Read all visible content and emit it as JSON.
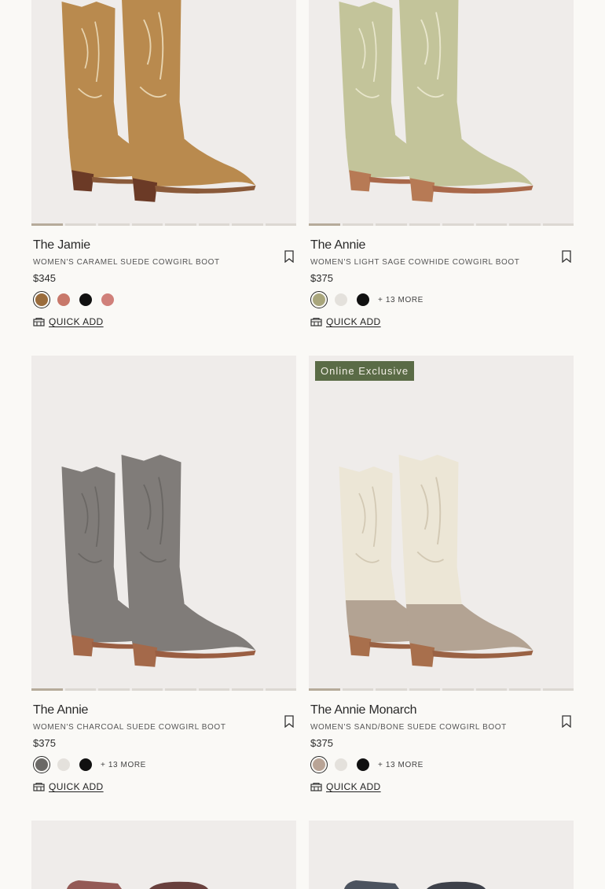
{
  "products": [
    {
      "name": "The Jamie",
      "description": "Women's Caramel Suede Cowgirl Boot",
      "price": "$345",
      "badge": "",
      "swatches": [
        "#9a6c3c",
        "#c8786a",
        "#111111",
        "#d0807a"
      ],
      "selected_swatch": 0,
      "more": "",
      "quick_add": "Quick Add",
      "boot_colors": {
        "shaft": "#b98a4e",
        "foot": "#b98a4e",
        "stitch": "#e7d4b0",
        "heel": "#6b3a26",
        "sole": "#8a5a3a"
      }
    },
    {
      "name": "The Annie",
      "description": "Women's Light Sage Cowhide Cowgirl Boot",
      "price": "$375",
      "badge": "",
      "swatches": [
        "#a9a67c",
        "#e4e1dc",
        "#111111"
      ],
      "selected_swatch": 0,
      "more": "+ 13 More",
      "quick_add": "Quick Add",
      "boot_colors": {
        "shaft": "#c3c49a",
        "foot": "#c3c49a",
        "stitch": "#e8e6cc",
        "heel": "#b77a55",
        "sole": "#a9684a"
      }
    },
    {
      "name": "The Annie",
      "description": "Women's Charcoal Suede Cowgirl Boot",
      "price": "$375",
      "badge": "",
      "swatches": [
        "#6b6966",
        "#e4e1dc",
        "#111111"
      ],
      "selected_swatch": 0,
      "more": "+ 13 More",
      "quick_add": "Quick Add",
      "boot_colors": {
        "shaft": "#807c79",
        "foot": "#807c79",
        "stitch": "#6a6764",
        "heel": "#a4694a",
        "sole": "#9a5e42"
      }
    },
    {
      "name": "The Annie Monarch",
      "description": "Women's Sand/Bone Suede Cowgirl Boot",
      "price": "$375",
      "badge": "Online Exclusive",
      "swatches": [
        "#b9a496",
        "#e4e1dc",
        "#111111"
      ],
      "selected_swatch": 0,
      "more": "+ 13 More",
      "quick_add": "Quick Add",
      "boot_colors": {
        "shaft": "#ece6d6",
        "foot": "#b3a393",
        "stitch": "#d2c8b3",
        "heel": "#a86f4c",
        "sole": "#9a6244"
      }
    },
    {
      "name": "",
      "description": "",
      "price": "",
      "badge": "",
      "swatches": [],
      "selected_swatch": 0,
      "more": "",
      "quick_add": "",
      "boot_colors": {
        "shaft": "#8a4a46",
        "foot": "#8a4a46",
        "stitch": "#8a4a46",
        "heel": "#5a2e2a",
        "sole": "#5a2e2a"
      }
    },
    {
      "name": "",
      "description": "",
      "price": "",
      "badge": "",
      "swatches": [],
      "selected_swatch": 0,
      "more": "",
      "quick_add": "",
      "boot_colors": {
        "shaft": "#3a4250",
        "foot": "#3a4250",
        "stitch": "#3a4250",
        "heel": "#2a2f38",
        "sole": "#2a2f38"
      }
    }
  ],
  "icons": {
    "bookmark": "bookmark-icon",
    "quick_add": "quick-add-icon"
  },
  "carousel_dots": 8
}
